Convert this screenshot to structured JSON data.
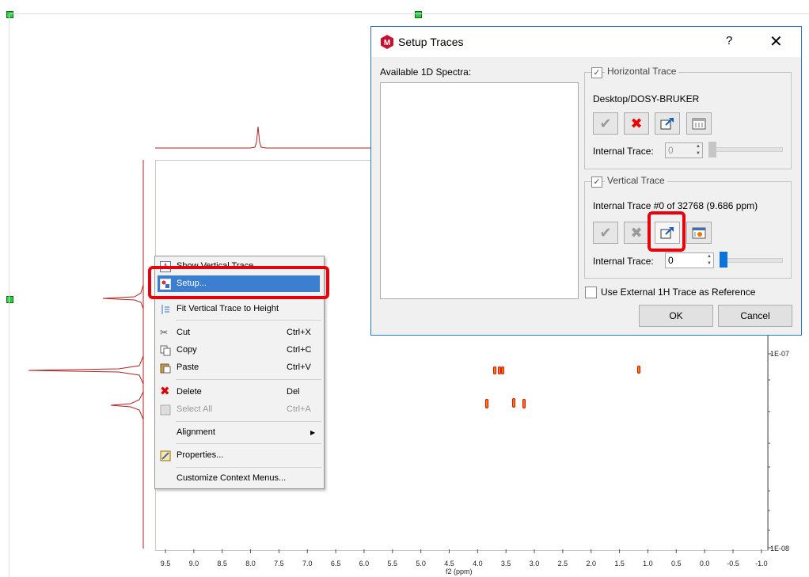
{
  "dialog": {
    "title": "Setup Traces",
    "help": "?",
    "close": "✕",
    "available_label": "Available 1D Spectra:",
    "horizontal": {
      "legend": "Horizontal Trace",
      "source": "Desktop/DOSY-BRUKER",
      "internal_label": "Internal Trace:",
      "internal_value": "0"
    },
    "vertical": {
      "legend": "Vertical Trace",
      "info": "Internal Trace #0 of 32768 (9.686 ppm)",
      "internal_label": "Internal Trace:",
      "internal_value": "0"
    },
    "use_external": "Use External 1H Trace as Reference",
    "ok": "OK",
    "cancel": "Cancel"
  },
  "context_menu": {
    "items": [
      {
        "label": "Show Vertical Trace"
      },
      {
        "label": "Setup..."
      },
      {
        "label": "Fit Vertical Trace to Height"
      },
      {
        "label": "Cut",
        "shortcut": "Ctrl+X"
      },
      {
        "label": "Copy",
        "shortcut": "Ctrl+C"
      },
      {
        "label": "Paste",
        "shortcut": "Ctrl+V"
      },
      {
        "label": "Delete",
        "shortcut": "Del"
      },
      {
        "label": "Select All",
        "shortcut": "Ctrl+A"
      },
      {
        "label": "Alignment"
      },
      {
        "label": "Properties..."
      },
      {
        "label": "Customize Context Menus..."
      }
    ]
  },
  "plot": {
    "x_ticks": [
      "9.5",
      "9.0",
      "8.5",
      "8.0",
      "7.5",
      "7.0",
      "6.5",
      "6.0",
      "5.5",
      "5.0",
      "4.5",
      "4.0",
      "3.5",
      "3.0",
      "2.5",
      "2.0",
      "1.5",
      "1.0",
      "0.5",
      "0.0",
      "-0.5",
      "-1.0"
    ],
    "x_title": "f2 (ppm)",
    "y_labels": [
      "1E-07",
      "1E-08"
    ]
  },
  "colors": {
    "accent": "#3c7fd1",
    "trace": "#b22222",
    "highlight": "#e8000b"
  }
}
